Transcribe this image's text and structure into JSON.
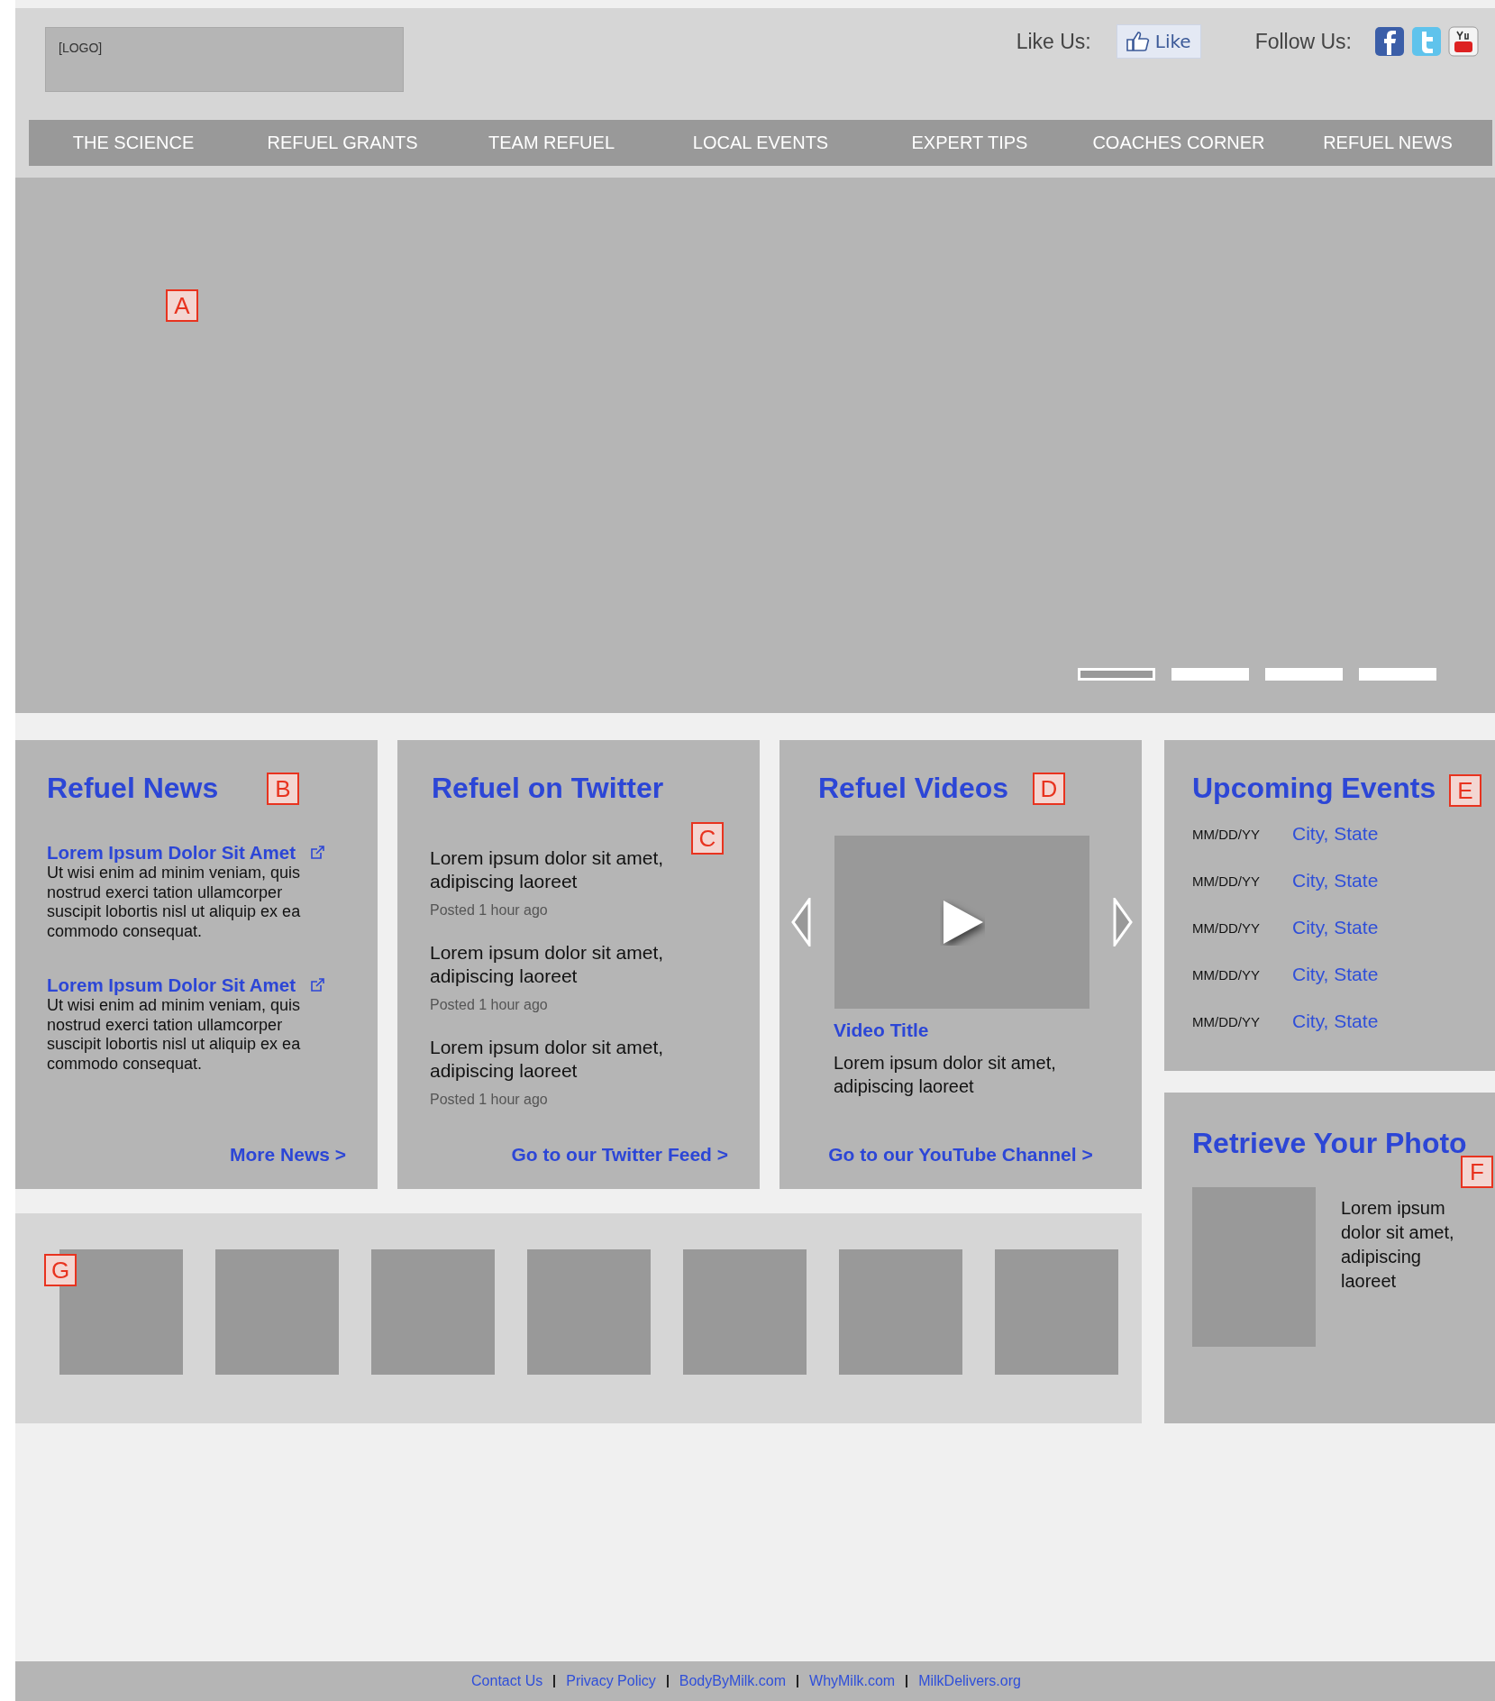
{
  "header": {
    "logo": "[LOGO]",
    "like_label": "Like Us:",
    "like_button": "Like",
    "follow_label": "Follow Us:"
  },
  "nav": {
    "items": [
      "THE SCIENCE",
      "REFUEL GRANTS",
      "TEAM REFUEL",
      "LOCAL EVENTS",
      "EXPERT TIPS",
      "COACHES CORNER",
      "REFUEL NEWS"
    ]
  },
  "hero": {
    "marker": "A",
    "slides": [
      {
        "selected": true
      },
      {
        "selected": false
      },
      {
        "selected": false
      },
      {
        "selected": false
      }
    ]
  },
  "news": {
    "title": "Refuel News",
    "marker": "B",
    "items": [
      {
        "title": "Lorem Ipsum Dolor Sit Amet",
        "body": "Ut wisi enim ad minim veniam, quis nostrud exerci tation ullamcorper suscipit lobortis nisl ut aliquip ex ea commodo consequat."
      },
      {
        "title": "Lorem Ipsum Dolor Sit Amet",
        "body": "Ut wisi enim ad minim veniam, quis nostrud exerci tation ullamcorper suscipit lobortis nisl ut aliquip ex ea commodo consequat."
      }
    ],
    "more_link": "More News >"
  },
  "twitter": {
    "title": "Refuel on Twitter",
    "marker": "C",
    "tweets": [
      {
        "text": "Lorem ipsum dolor sit amet, adipiscing laoreet",
        "time": "Posted 1 hour ago"
      },
      {
        "text": "Lorem ipsum dolor sit amet, adipiscing laoreet",
        "time": "Posted 1 hour ago"
      },
      {
        "text": "Lorem ipsum dolor sit amet, adipiscing laoreet",
        "time": "Posted 1 hour ago"
      }
    ],
    "link": "Go to our Twitter Feed >"
  },
  "videos": {
    "title": "Refuel Videos",
    "marker": "D",
    "video_title": "Video Title",
    "description": "Lorem ipsum dolor sit amet, adipiscing laoreet",
    "link": "Go to our YouTube Channel >"
  },
  "events": {
    "title": "Upcoming Events",
    "marker": "E",
    "rows": [
      {
        "date": "MM/DD/YY",
        "place": "City, State"
      },
      {
        "date": "MM/DD/YY",
        "place": "City, State"
      },
      {
        "date": "MM/DD/YY",
        "place": "City, State"
      },
      {
        "date": "MM/DD/YY",
        "place": "City, State"
      },
      {
        "date": "MM/DD/YY",
        "place": "City, State"
      }
    ]
  },
  "photo": {
    "title": "Retrieve Your Photo",
    "marker": "F",
    "text": "Lorem ipsum dolor sit amet, adipiscing laoreet"
  },
  "gallery": {
    "marker": "G",
    "thumbnails": [
      {
        "kind": "placeholder"
      },
      {
        "kind": "placeholder"
      },
      {
        "kind": "placeholder"
      },
      {
        "kind": "placeholder"
      },
      {
        "kind": "placeholder"
      },
      {
        "kind": "placeholder"
      },
      {
        "kind": "placeholder"
      }
    ]
  },
  "footer": {
    "links": [
      "Contact Us",
      "Privacy Policy",
      "BodyByMilk.com",
      "WhyMilk.com",
      "MilkDelivers.org"
    ]
  }
}
